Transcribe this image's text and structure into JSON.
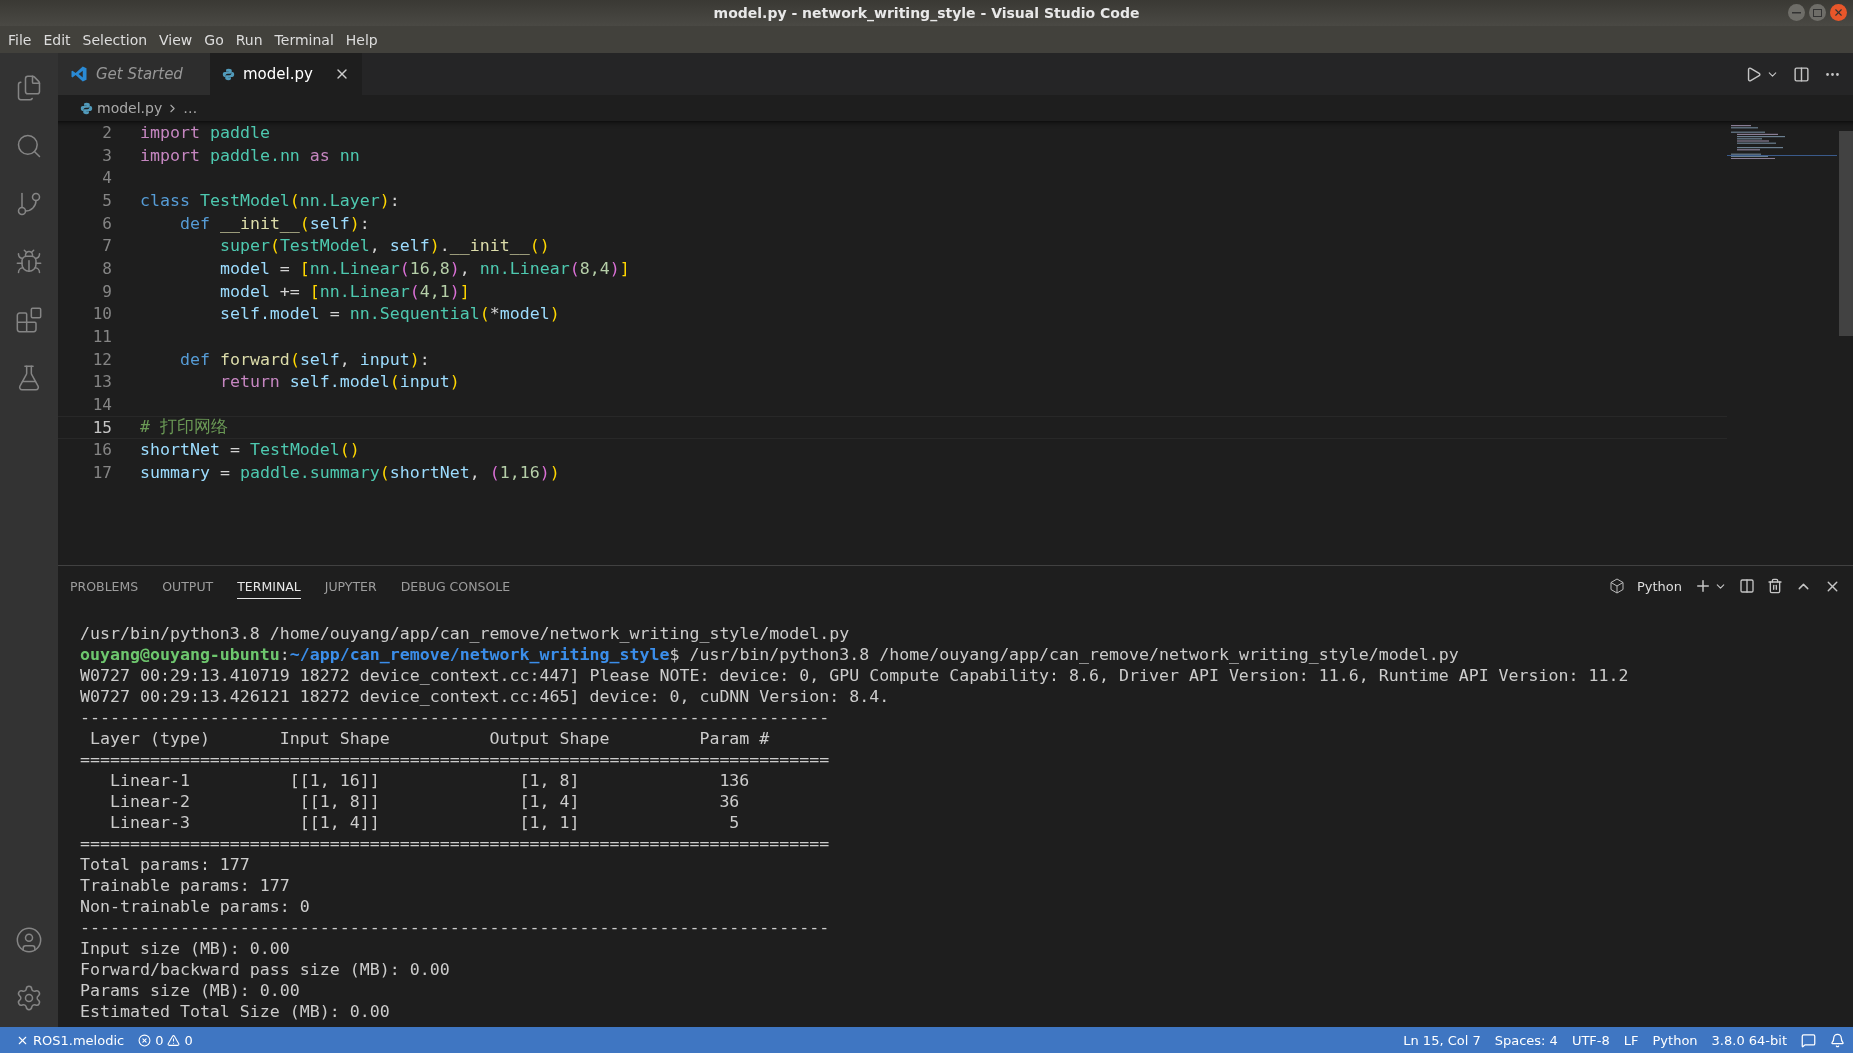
{
  "window": {
    "title": "model.py - network_writing_style - Visual Studio Code"
  },
  "menu": [
    "File",
    "Edit",
    "Selection",
    "View",
    "Go",
    "Run",
    "Terminal",
    "Help"
  ],
  "tabs": [
    {
      "label": "Get Started",
      "kind": "welcome",
      "selected": false
    },
    {
      "label": "model.py",
      "kind": "python",
      "selected": true
    }
  ],
  "breadcrumb": [
    "model.py",
    "…"
  ],
  "editor": {
    "lines": [
      {
        "number": "2",
        "current": false,
        "tokens": [
          {
            "text": "import",
            "kind": "keyword"
          },
          {
            "text": " paddle",
            "kind": "class"
          }
        ]
      },
      {
        "number": "3",
        "current": false,
        "tokens": [
          {
            "text": "import",
            "kind": "keyword"
          },
          {
            "text": " paddle.nn",
            "kind": "class"
          },
          {
            "text": " as",
            "kind": "keyword"
          },
          {
            "text": " nn",
            "kind": "class"
          }
        ]
      },
      {
        "number": "4",
        "current": false
      },
      {
        "number": "5",
        "current": false,
        "tokens": [
          {
            "text": "class",
            "kind": "storage"
          },
          {
            "text": " TestModel",
            "kind": "class"
          },
          {
            "text": "(",
            "kind": "bracket"
          },
          {
            "text": "nn.Layer",
            "kind": "class"
          },
          {
            "text": ")",
            "kind": "bracket"
          },
          {
            "text": ":",
            "kind": "plain"
          }
        ]
      },
      {
        "number": "6",
        "current": false,
        "tokens": [
          {
            "text": "    def",
            "kind": "storage"
          },
          {
            "text": " __init__",
            "kind": "function"
          },
          {
            "text": "(",
            "kind": "bracket"
          },
          {
            "text": "self",
            "kind": "variable"
          },
          {
            "text": ")",
            "kind": "bracket"
          },
          {
            "text": ":",
            "kind": "plain"
          }
        ]
      },
      {
        "number": "7",
        "current": false,
        "tokens": [
          {
            "text": "        super",
            "kind": "class"
          },
          {
            "text": "(",
            "kind": "bracket"
          },
          {
            "text": "TestModel",
            "kind": "class"
          },
          {
            "text": ",",
            "kind": "plain"
          },
          {
            "text": " self",
            "kind": "variable"
          },
          {
            "text": ")",
            "kind": "bracket"
          },
          {
            "text": ".",
            "kind": "plain"
          },
          {
            "text": "__init__",
            "kind": "function"
          },
          {
            "text": "()",
            "kind": "bracket"
          }
        ]
      },
      {
        "number": "8",
        "current": false,
        "tokens": [
          {
            "text": "        model",
            "kind": "variable"
          },
          {
            "text": " = ",
            "kind": "plain"
          },
          {
            "text": "[",
            "kind": "bracket"
          },
          {
            "text": "nn.Linear",
            "kind": "class"
          },
          {
            "text": "(",
            "kind": "inner"
          },
          {
            "text": "16,8",
            "kind": "number"
          },
          {
            "text": ")",
            "kind": "inner"
          },
          {
            "text": ", ",
            "kind": "plain"
          },
          {
            "text": "nn.Linear",
            "kind": "class"
          },
          {
            "text": "(",
            "kind": "inner"
          },
          {
            "text": "8,4",
            "kind": "number"
          },
          {
            "text": ")",
            "kind": "inner"
          },
          {
            "text": "]",
            "kind": "bracket"
          }
        ]
      },
      {
        "number": "9",
        "current": false,
        "tokens": [
          {
            "text": "        model",
            "kind": "variable"
          },
          {
            "text": " += ",
            "kind": "plain"
          },
          {
            "text": "[",
            "kind": "bracket"
          },
          {
            "text": "nn.Linear",
            "kind": "class"
          },
          {
            "text": "(",
            "kind": "inner"
          },
          {
            "text": "4,1",
            "kind": "number"
          },
          {
            "text": ")",
            "kind": "inner"
          },
          {
            "text": "]",
            "kind": "bracket"
          }
        ]
      },
      {
        "number": "10",
        "current": false,
        "tokens": [
          {
            "text": "        self.model",
            "kind": "variable"
          },
          {
            "text": " = ",
            "kind": "plain"
          },
          {
            "text": "nn.Sequential",
            "kind": "class"
          },
          {
            "text": "(",
            "kind": "bracket"
          },
          {
            "text": "*",
            "kind": "plain"
          },
          {
            "text": "model",
            "kind": "variable"
          },
          {
            "text": ")",
            "kind": "bracket"
          }
        ]
      },
      {
        "number": "11",
        "current": false
      },
      {
        "number": "12",
        "current": false,
        "tokens": [
          {
            "text": "    def",
            "kind": "storage"
          },
          {
            "text": " forward",
            "kind": "function"
          },
          {
            "text": "(",
            "kind": "bracket"
          },
          {
            "text": "self",
            "kind": "variable"
          },
          {
            "text": ",",
            "kind": "plain"
          },
          {
            "text": " input",
            "kind": "variable"
          },
          {
            "text": ")",
            "kind": "bracket"
          },
          {
            "text": ":",
            "kind": "plain"
          }
        ]
      },
      {
        "number": "13",
        "current": false,
        "tokens": [
          {
            "text": "        return",
            "kind": "keyword"
          },
          {
            "text": " self.model",
            "kind": "variable"
          },
          {
            "text": "(",
            "kind": "bracket"
          },
          {
            "text": "input",
            "kind": "variable"
          },
          {
            "text": ")",
            "kind": "bracket"
          }
        ]
      },
      {
        "number": "14",
        "current": false
      },
      {
        "number": "15",
        "current": true,
        "tokens": [
          {
            "text": "# 打印网络",
            "kind": "comment"
          }
        ]
      },
      {
        "number": "16",
        "current": false,
        "tokens": [
          {
            "text": "shortNet",
            "kind": "variable"
          },
          {
            "text": " = ",
            "kind": "plain"
          },
          {
            "text": "TestModel",
            "kind": "class"
          },
          {
            "text": "()",
            "kind": "bracket"
          }
        ]
      },
      {
        "number": "17",
        "current": false,
        "tokens": [
          {
            "text": "summary",
            "kind": "variable"
          },
          {
            "text": " = ",
            "kind": "plain"
          },
          {
            "text": "paddle.summary",
            "kind": "class"
          },
          {
            "text": "(",
            "kind": "bracket"
          },
          {
            "text": "shortNet",
            "kind": "variable"
          },
          {
            "text": ", ",
            "kind": "plain"
          },
          {
            "text": "(",
            "kind": "inner"
          },
          {
            "text": "1,16",
            "kind": "number"
          },
          {
            "text": ")",
            "kind": "inner"
          },
          {
            "text": ")",
            "kind": "bracket"
          }
        ]
      }
    ]
  },
  "panel": {
    "tabs": [
      {
        "label": "PROBLEMS",
        "selected": false
      },
      {
        "label": "OUTPUT",
        "selected": false
      },
      {
        "label": "TERMINAL",
        "selected": true
      },
      {
        "label": "JUPYTER",
        "selected": false
      },
      {
        "label": "DEBUG CONSOLE",
        "selected": false
      }
    ],
    "shell": "Python",
    "terminal": [
      {
        "kind": "plain",
        "text": "/usr/bin/python3.8 /home/ouyang/app/can_remove/network_writing_style/model.py"
      },
      {
        "kind": "prompt",
        "user": "ouyang@ouyang-ubuntu",
        "separator": ":",
        "path": "~/app/can_remove/network_writing_style",
        "text": "$ /usr/bin/python3.8 /home/ouyang/app/can_remove/network_writing_style/model.py"
      },
      {
        "kind": "plain",
        "text": "W0727 00:29:13.410719 18272 device_context.cc:447] Please NOTE: device: 0, GPU Compute Capability: 8.6, Driver API Version: 11.6, Runtime API Version: 11.2"
      },
      {
        "kind": "plain",
        "text": "W0727 00:29:13.426121 18272 device_context.cc:465] device: 0, cuDNN Version: 8.4."
      },
      {
        "kind": "plain",
        "text": "---------------------------------------------------------------------------"
      },
      {
        "kind": "plain",
        "text": " Layer (type)       Input Shape          Output Shape         Param #"
      },
      {
        "kind": "plain",
        "text": "==========================================================================="
      },
      {
        "kind": "plain",
        "text": "   Linear-1          [[1, 16]]              [1, 8]              136"
      },
      {
        "kind": "plain",
        "text": "   Linear-2           [[1, 8]]              [1, 4]              36"
      },
      {
        "kind": "plain",
        "text": "   Linear-3           [[1, 4]]              [1, 1]               5"
      },
      {
        "kind": "plain",
        "text": "==========================================================================="
      },
      {
        "kind": "plain",
        "text": "Total params: 177"
      },
      {
        "kind": "plain",
        "text": "Trainable params: 177"
      },
      {
        "kind": "plain",
        "text": "Non-trainable params: 0"
      },
      {
        "kind": "plain",
        "text": "---------------------------------------------------------------------------"
      },
      {
        "kind": "plain",
        "text": "Input size (MB): 0.00"
      },
      {
        "kind": "plain",
        "text": "Forward/backward pass size (MB): 0.00"
      },
      {
        "kind": "plain",
        "text": "Params size (MB): 0.00"
      },
      {
        "kind": "plain",
        "text": "Estimated Total Size (MB): 0.00"
      }
    ]
  },
  "status_bar": {
    "remote": "ROS1.melodic",
    "errors": "0",
    "warnings": "0",
    "right": [
      "Ln 15, Col 7",
      "Spaces: 4",
      "UTF-8",
      "LF",
      "Python",
      "3.8.0 64-bit"
    ]
  }
}
